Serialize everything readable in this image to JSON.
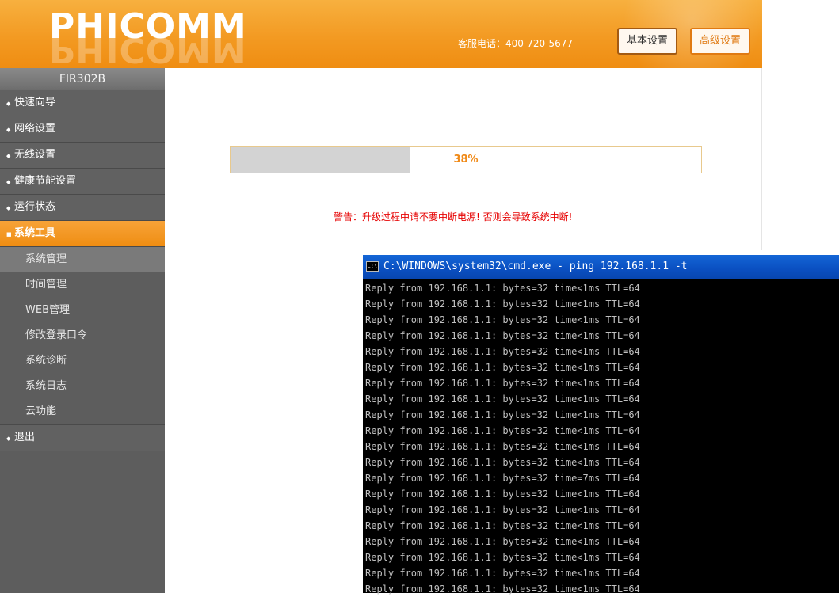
{
  "header": {
    "logo": "PHICOMM",
    "hotline": "客服电话：400-720-5677",
    "basic_label": "基本设置",
    "advanced_label": "高级设置"
  },
  "sidebar": {
    "model": "FIR302B",
    "menu": [
      {
        "bullet": "◆",
        "label": "快速向导"
      },
      {
        "bullet": "◆",
        "label": "网络设置"
      },
      {
        "bullet": "◆",
        "label": "无线设置"
      },
      {
        "bullet": "◆",
        "label": "健康节能设置"
      },
      {
        "bullet": "◆",
        "label": "运行状态"
      },
      {
        "bullet": "■",
        "label": "系统工具"
      }
    ],
    "submenu": [
      "系统管理",
      "时间管理",
      "WEB管理",
      "修改登录口令",
      "系统诊断",
      "系统日志",
      "云功能"
    ],
    "logout": {
      "bullet": "◆",
      "label": "退出"
    }
  },
  "upgrade": {
    "progress_value": 0.38,
    "progress_text": "38%",
    "warning": "警告：升级过程中请不要中断电源! 否则会导致系统中断!"
  },
  "cmd": {
    "title": "C:\\WINDOWS\\system32\\cmd.exe - ping 192.168.1.1 -t",
    "lines": [
      "Reply from 192.168.1.1: bytes=32 time<1ms TTL=64",
      "Reply from 192.168.1.1: bytes=32 time<1ms TTL=64",
      "Reply from 192.168.1.1: bytes=32 time<1ms TTL=64",
      "Reply from 192.168.1.1: bytes=32 time<1ms TTL=64",
      "Reply from 192.168.1.1: bytes=32 time<1ms TTL=64",
      "Reply from 192.168.1.1: bytes=32 time<1ms TTL=64",
      "Reply from 192.168.1.1: bytes=32 time<1ms TTL=64",
      "Reply from 192.168.1.1: bytes=32 time<1ms TTL=64",
      "Reply from 192.168.1.1: bytes=32 time<1ms TTL=64",
      "Reply from 192.168.1.1: bytes=32 time<1ms TTL=64",
      "Reply from 192.168.1.1: bytes=32 time<1ms TTL=64",
      "Reply from 192.168.1.1: bytes=32 time<1ms TTL=64",
      "Reply from 192.168.1.1: bytes=32 time=7ms TTL=64",
      "Reply from 192.168.1.1: bytes=32 time<1ms TTL=64",
      "Reply from 192.168.1.1: bytes=32 time<1ms TTL=64",
      "Reply from 192.168.1.1: bytes=32 time<1ms TTL=64",
      "Reply from 192.168.1.1: bytes=32 time<1ms TTL=64",
      "Reply from 192.168.1.1: bytes=32 time<1ms TTL=64",
      "Reply from 192.168.1.1: bytes=32 time<1ms TTL=64",
      "Reply from 192.168.1.1: bytes=32 time<1ms TTL=64"
    ]
  },
  "colors": {
    "accent": "#f39a22",
    "sidebar_bg": "#5d5d5d",
    "warning": "#e60000",
    "cmd_title": "#0a4fc1"
  }
}
